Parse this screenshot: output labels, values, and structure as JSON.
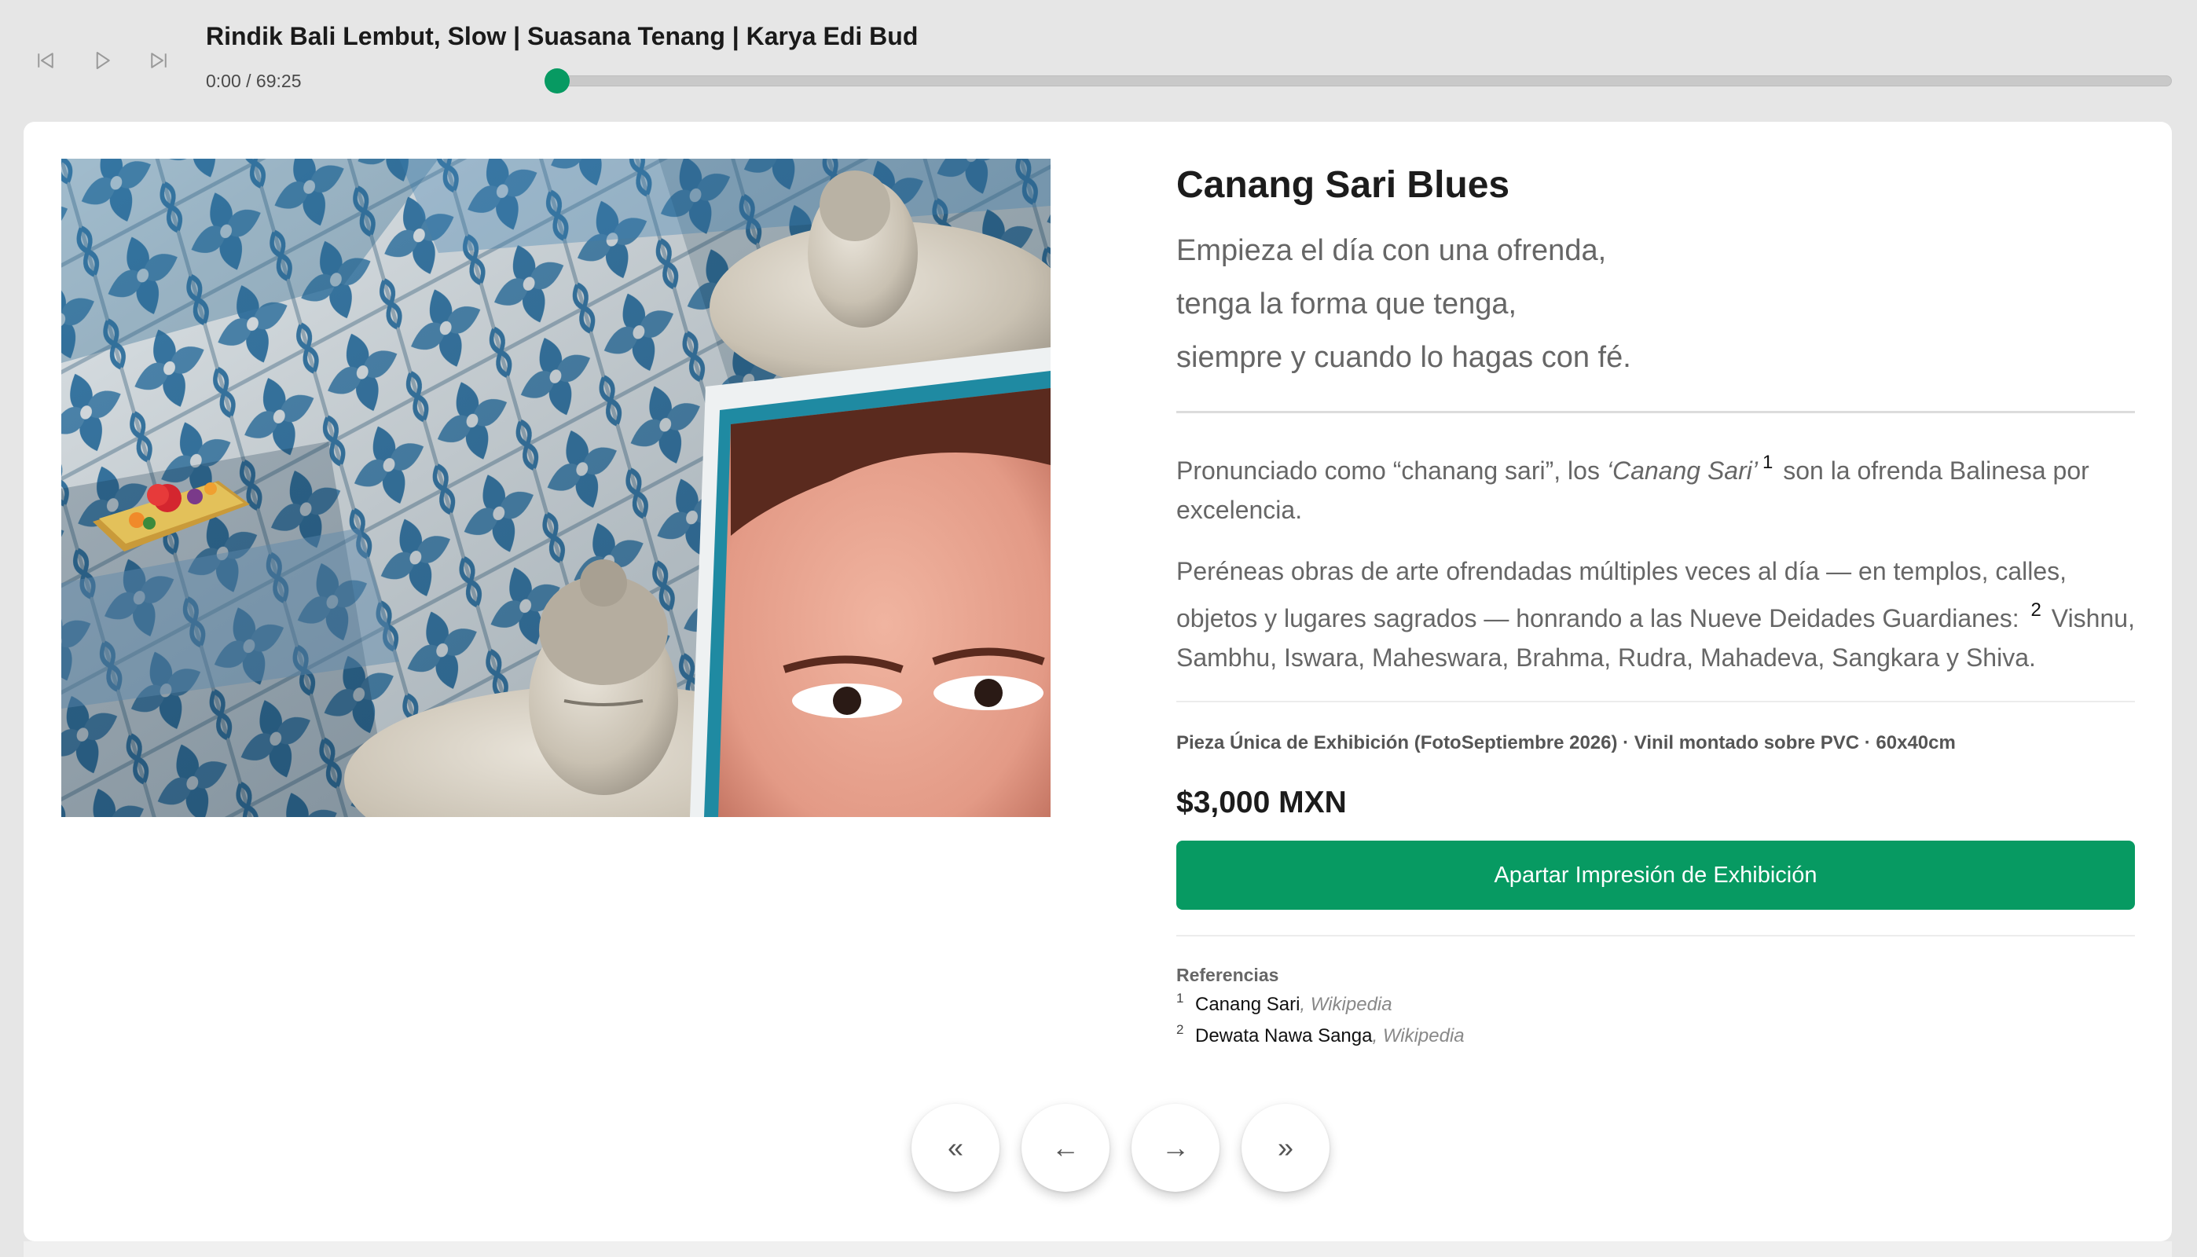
{
  "player": {
    "track_title": "Rindik Bali Lembut, Slow | Suasana Tenang | Karya Edi Bud",
    "time": "0:00 / 69:25",
    "progress": 0,
    "accent_color": "#079a62",
    "controls": {
      "prev_icon": "skip-back-icon",
      "play_icon": "play-icon",
      "next_icon": "skip-forward-icon"
    }
  },
  "artwork": {
    "title": "Canang Sari Blues",
    "poem": [
      "Empieza el día con una ofrenda,",
      "tenga la forma que tenga,",
      "siempre y cuando lo hagas con fé."
    ],
    "description": {
      "p1_before": "Pronunciado como “chanang sari”, los ",
      "p1_term": "‘Canang Sari’",
      "p1_ref": "1",
      "p1_after": " son la ofrenda Balinesa por excelencia.",
      "p2_before": "Peréneas obras de arte ofrendadas múltiples veces al día — en templos, calles, objetos y lugares sagrados — honrando a las Nueve Deidades Guardianes: ",
      "p2_ref": "2",
      "p2_after": " Vishnu, Sambhu, Iswara, Maheswara, Brahma, Rudra, Mahadeva, Sangkara y Shiva."
    },
    "specs": "Pieza Única de Exhibición (FotoSeptiembre 2026) · Vinil montado sobre PVC · 60x40cm",
    "price": "$3,000 MXN",
    "cta_label": "Apartar Impresión de Exhibición"
  },
  "references": {
    "heading": "Referencias",
    "items": [
      {
        "num": "1",
        "title": "Canang Sari",
        "sep": ", ",
        "source": "Wikipedia"
      },
      {
        "num": "2",
        "title": "Dewata Nawa Sanga",
        "sep": ", ",
        "source": "Wikipedia"
      }
    ]
  },
  "pagination": {
    "first": "«",
    "prev": "←",
    "next": "→",
    "last": "»"
  }
}
